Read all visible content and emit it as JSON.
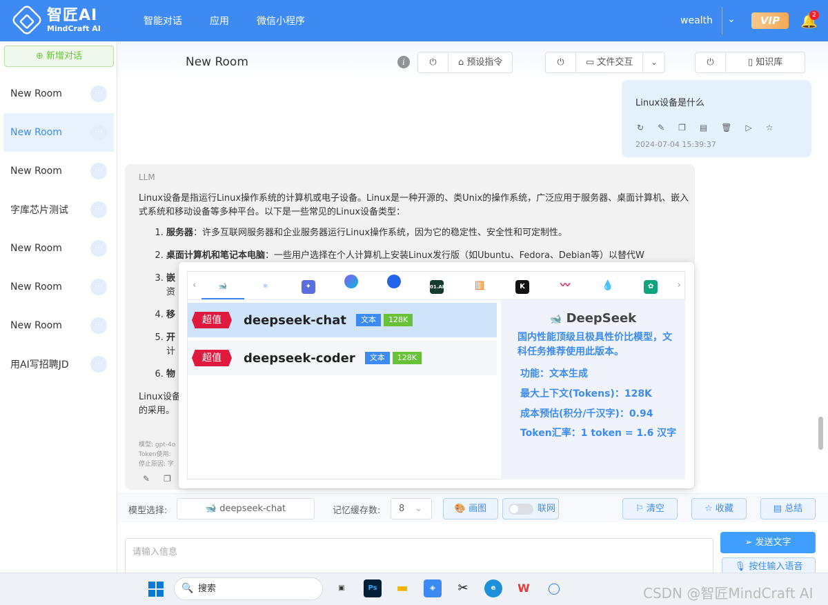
{
  "header": {
    "logo_cn": "智匠AI",
    "logo_en": "MindCraft AI",
    "nav": [
      "智能对话",
      "应用",
      "微信小程序"
    ],
    "user": "wealth",
    "vip": "VIP",
    "notification_count": "2"
  },
  "sidebar": {
    "new_chat": "新增对话",
    "rooms": [
      "New Room",
      "New Room",
      "New Room",
      "字库芯片测试",
      "New Room",
      "New Room",
      "New Room",
      "用AI写招聘JD"
    ],
    "active_index": 1
  },
  "chat_header": {
    "title": "New Room",
    "preset_label": "预设指令",
    "file_label": "文件交互",
    "kb_label": "知识库"
  },
  "user_message": {
    "text": "Linux设备是什么",
    "time": "2024-07-04 15:39:37"
  },
  "bot_message": {
    "sender": "LLM",
    "intro": "Linux设备是指运行Linux操作系统的计算机或电子设备。Linux是一种开源的、类Unix的操作系统，广泛应用于服务器、桌面计算机、嵌入式系统和移动设备等多种平台。以下是一些常见的Linux设备类型：",
    "items": [
      {
        "bold": "服务器",
        "text": "：许多互联网服务器和企业服务器运行Linux操作系统，因为它的稳定性、安全性和可定制性。"
      },
      {
        "bold": "桌面计算机和笔记本电脑",
        "text": "：一些用户选择在个人计算机上安装Linux发行版（如Ubuntu、Fedora、Debian等）以替代W"
      },
      {
        "bold": "嵌",
        "text": "资"
      },
      {
        "bold": "移",
        "text": ""
      },
      {
        "bold": "开",
        "text": "计"
      },
      {
        "bold": "物",
        "text": ""
      }
    ],
    "outro": "Linux设备",
    "outro2": "的采用。",
    "footer1": "模型: gpt-4o",
    "footer2": "Token使用:",
    "footer3": "停止原因: 字"
  },
  "model_popup": {
    "providers": [
      "deepseek",
      "atom",
      "openai-like",
      "swirl",
      "edge-ball",
      "01.AI",
      "stripes",
      "K",
      "wave",
      "drop",
      "chatgpt"
    ],
    "models": [
      {
        "tag": "超值",
        "name": "deepseek-chat",
        "type": "文本",
        "context": "128K"
      },
      {
        "tag": "超值",
        "name": "deepseek-coder",
        "type": "文本",
        "context": "128K"
      }
    ],
    "detail_brand": "DeepSeek",
    "detail_desc": "国内性能顶级且极具性价比模型，文科任务推荐使用此版本。",
    "detail_func": "功能：文本生成",
    "detail_ctx": "最大上下文(Tokens)：128K",
    "detail_cost": "成本预估(积分/千汉字)：0.94",
    "detail_rate": "Token汇率：1 token = 1.6 汉字"
  },
  "bottombar": {
    "model_label": "模型选择:",
    "model_value": "deepseek-chat",
    "memory_label": "记忆缓存数:",
    "memory_value": "8",
    "draw": "画图",
    "web": "联网",
    "clear": "清空",
    "fav": "收藏",
    "summary": "总结"
  },
  "input": {
    "placeholder": "请输入信息",
    "send": "发送文字",
    "voice": "按住输入语音"
  },
  "taskbar": {
    "search": "搜索",
    "watermark": "CSDN @智匠MindCraft AI"
  },
  "colors": {
    "brand": "#3d8bf2",
    "tag_red": "#e0193e",
    "tag_green": "#67c23a"
  }
}
